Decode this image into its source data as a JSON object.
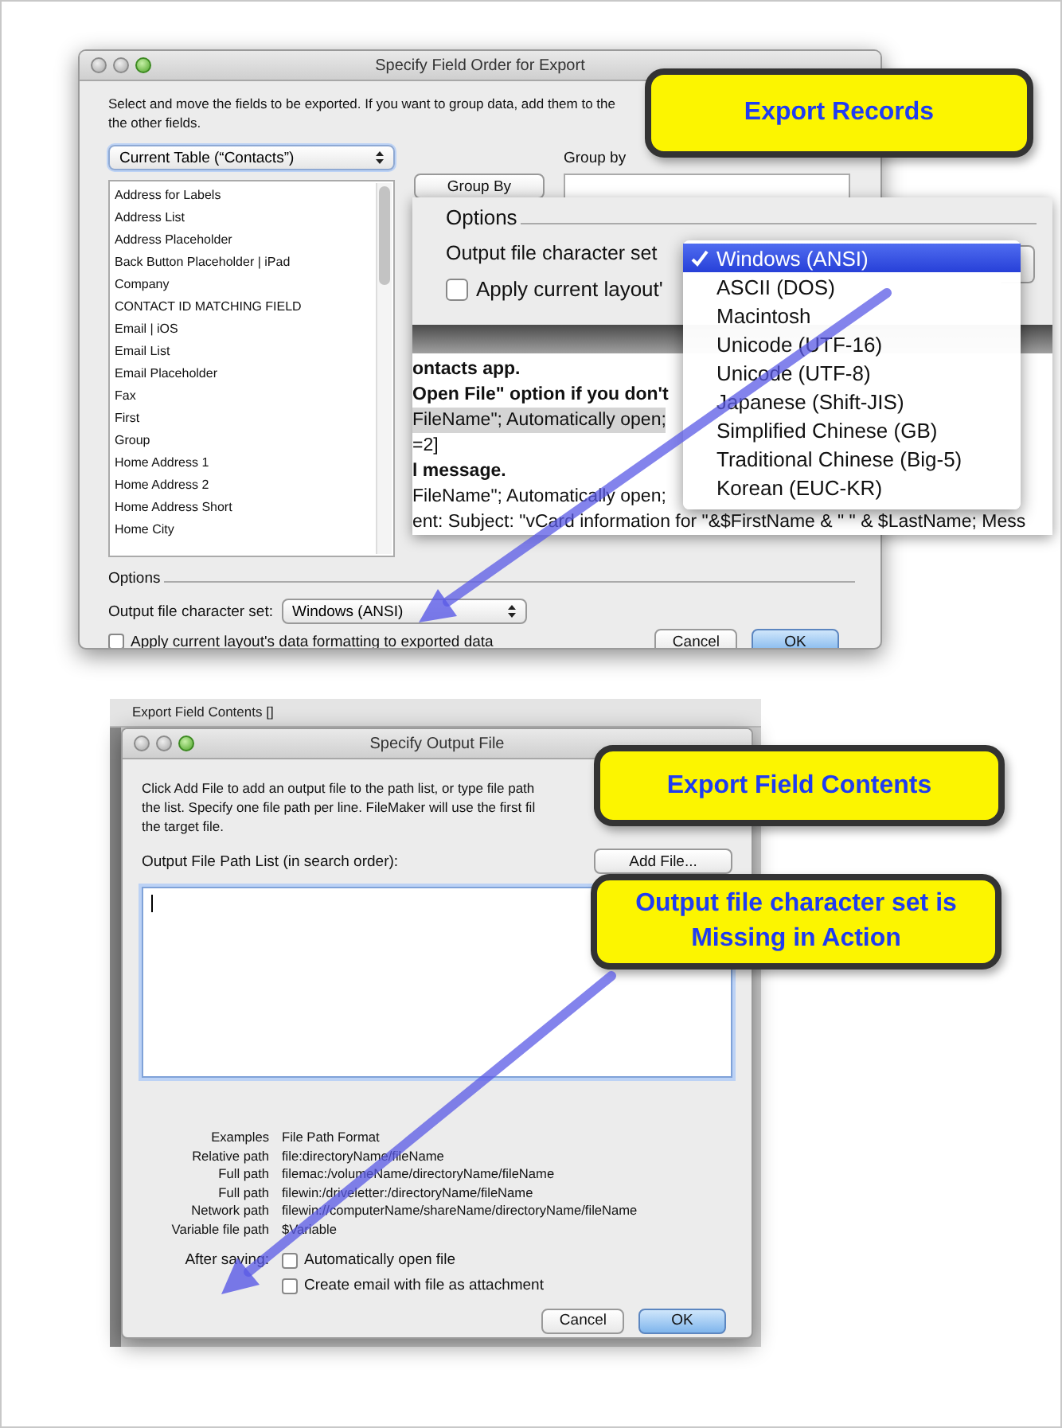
{
  "export_records_dialog": {
    "title": "Specify Field Order for Export",
    "instructions": [
      "Select and move the fields to be exported.  If you want to group data, add them to the",
      "the other fields."
    ],
    "table_selector": "Current Table (“Contacts”)",
    "fields": [
      "Address for Labels",
      "Address List",
      "Address Placeholder",
      "Back Button Placeholder | iPad",
      "Company",
      "CONTACT ID MATCHING FIELD",
      "Email | iOS",
      "Email List",
      "Email Placeholder",
      "Fax",
      "First",
      "Group",
      "Home Address 1",
      "Home Address 2",
      "Home Address Short",
      "Home City"
    ],
    "group_by_button": "Group By",
    "group_by_label": "Group by",
    "options_heading": "Options",
    "charset_label": "Output file character set:",
    "charset_value": "Windows (ANSI)",
    "formatting_checkbox": {
      "label": "Apply current layout's data formatting to exported data",
      "checked": false
    },
    "buttons": [
      {
        "label": "Cancel",
        "kind": "normal"
      },
      {
        "label": "OK",
        "kind": "default"
      }
    ]
  },
  "zoom_inset": {
    "options_heading": "Options",
    "charset_label": "Output file character set",
    "formatting_checkbox": {
      "label": "Apply current layout'",
      "checked": false
    },
    "charset_menu": [
      {
        "label": "Windows (ANSI)",
        "selected": true
      },
      {
        "label": "ASCII (DOS)",
        "selected": false
      },
      {
        "label": "Macintosh",
        "selected": false
      },
      {
        "label": "Unicode (UTF-16)",
        "selected": false
      },
      {
        "label": "Unicode (UTF-8)",
        "selected": false
      },
      {
        "label": "Japanese (Shift-JIS)",
        "selected": false
      },
      {
        "label": "Simplified Chinese (GB)",
        "selected": false
      },
      {
        "label": "Traditional Chinese (Big-5)",
        "selected": false
      },
      {
        "label": "Korean (EUC-KR)",
        "selected": false
      }
    ],
    "script_lines": [
      {
        "text": "ontacts app.",
        "kind": "bold"
      },
      {
        "text": "Open File\" option if you don't",
        "kind": "bold"
      },
      {
        "text": "FileName\"; Automatically open; ",
        "kind": "highlighted"
      },
      {
        "text": "=2]",
        "kind": "plain"
      },
      {
        "text": "l message.",
        "kind": "bold"
      },
      {
        "text": "FileName\"; Automatically open; ",
        "kind": "plain"
      },
      {
        "text": "ent: Subject: \"vCard information for \"&$FirstName & \" \" & $LastName; Mess",
        "kind": "plain"
      }
    ]
  },
  "output_file_dialog": {
    "parent_title": "Export Field Contents []",
    "title": "Specify Output File",
    "instructions": [
      "Click Add File to add an output file to the path list, or type file path",
      "the list. Specify one file path per line. FileMaker will use the first fil",
      "the target file."
    ],
    "path_list_label": "Output File Path List (in search order):",
    "add_file_button": "Add File...",
    "examples_header": {
      "type": "Examples",
      "format": "File Path Format"
    },
    "examples": [
      {
        "type": "Relative path",
        "format": "file:directoryName/fileName"
      },
      {
        "type": "Full path",
        "format": "filemac:/volumeName/directoryName/fileName"
      },
      {
        "type": "Full path",
        "format": "filewin:/driveletter:/directoryName/fileName"
      },
      {
        "type": "Network path",
        "format": "filewin://computerName/shareName/directoryName/fileName"
      },
      {
        "type": "Variable file path",
        "format": "$Variable"
      }
    ],
    "after_saving_label": "After saving:",
    "after_saving_options": [
      {
        "label": "Automatically open file",
        "checked": false
      },
      {
        "label": "Create email with file as attachment",
        "checked": false
      }
    ],
    "buttons": [
      {
        "label": "Cancel",
        "kind": "normal"
      },
      {
        "label": "OK",
        "kind": "default"
      }
    ]
  },
  "callouts": [
    {
      "lines": [
        "Export Records"
      ]
    },
    {
      "lines": [
        "Export Field Contents"
      ]
    },
    {
      "lines": [
        "Output file character set is",
        "Missing in Action"
      ]
    }
  ]
}
